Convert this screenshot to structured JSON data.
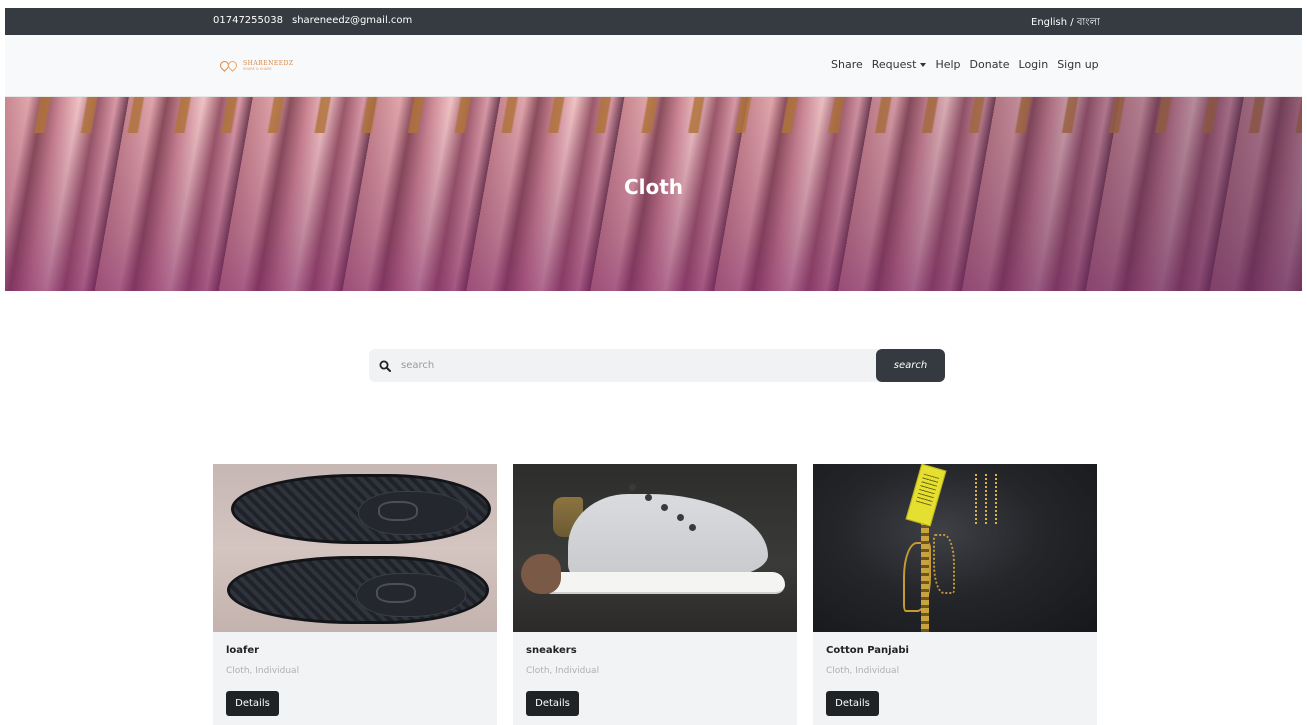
{
  "topbar": {
    "phone": "01747255038",
    "email": "shareneedz@gmail.com",
    "language": "English / বাংলা"
  },
  "brand": {
    "name": "SHARENEEDZ",
    "tagline": "SHARE & SHARE"
  },
  "nav": {
    "share": "Share",
    "request": "Request",
    "help": "Help",
    "donate": "Donate",
    "login": "Login",
    "signup": "Sign up"
  },
  "hero": {
    "title": "Cloth"
  },
  "search": {
    "placeholder": "search",
    "button": "search"
  },
  "cards": [
    {
      "title": "loafer",
      "meta": "Cloth, Individual",
      "button": "Details"
    },
    {
      "title": "sneakers",
      "meta": "Cloth, Individual",
      "button": "Details"
    },
    {
      "title": "Cotton Panjabi",
      "meta": "Cloth, Individual",
      "button": "Details"
    }
  ],
  "colors": {
    "topbar": "#353b40",
    "navbar": "#f8f9fa",
    "button": "#343a40",
    "brand": "#d8863f"
  }
}
